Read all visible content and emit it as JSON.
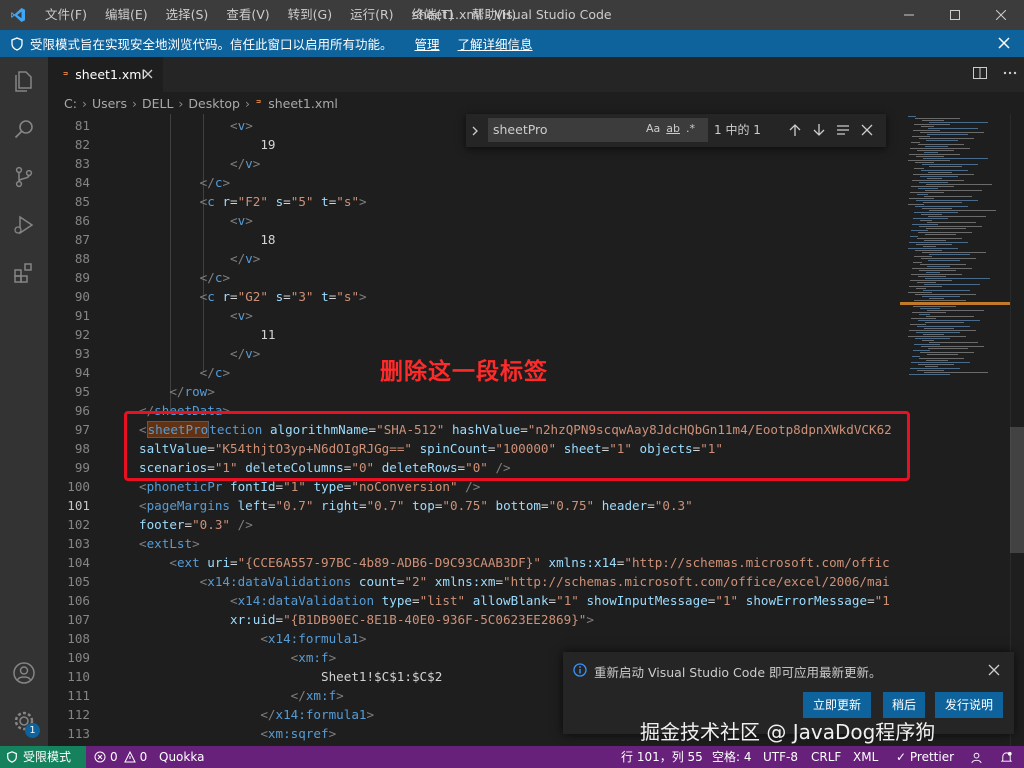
{
  "window": {
    "title": "sheet1.xml - Visual Studio Code",
    "menu": [
      "文件(F)",
      "编辑(E)",
      "选择(S)",
      "查看(V)",
      "转到(G)",
      "运行(R)",
      "终端(T)",
      "帮助(H)"
    ]
  },
  "banner": {
    "message": "受限模式旨在实现安全地浏览代码。信任此窗口以启用所有功能。",
    "manage": "管理",
    "learn_more": "了解详细信息"
  },
  "tab": {
    "label": "sheet1.xml"
  },
  "breadcrumb": {
    "items": [
      "C:",
      "Users",
      "DELL",
      "Desktop",
      "sheet1.xml"
    ]
  },
  "find": {
    "query": "sheetPro",
    "match_case": "Aa",
    "whole_word": "ab",
    "regex": ".*",
    "result": "1 中的 1"
  },
  "code": {
    "cur_line": 101,
    "lines": [
      {
        "n": 81,
        "t": "            <v>"
      },
      {
        "n": 82,
        "t": "                19"
      },
      {
        "n": 83,
        "t": "            </v>"
      },
      {
        "n": 84,
        "t": "        </c>"
      },
      {
        "n": 85,
        "t": "        <c r=\"F2\" s=\"5\" t=\"s\">"
      },
      {
        "n": 86,
        "t": "            <v>"
      },
      {
        "n": 87,
        "t": "                18"
      },
      {
        "n": 88,
        "t": "            </v>"
      },
      {
        "n": 89,
        "t": "        </c>"
      },
      {
        "n": 90,
        "t": "        <c r=\"G2\" s=\"3\" t=\"s\">"
      },
      {
        "n": 91,
        "t": "            <v>"
      },
      {
        "n": 92,
        "t": "                11"
      },
      {
        "n": 93,
        "t": "            </v>"
      },
      {
        "n": 94,
        "t": "        </c>"
      },
      {
        "n": 95,
        "t": "    </row>"
      },
      {
        "n": 96,
        "t": "</sheetData>"
      },
      {
        "n": 97,
        "t": "<sheetProtection algorithmName=\"SHA-512\" hashValue=\"n2hzQPN9scqwAay8JdcHQbGn11m4/Eootp8dpnXWkdVCK62"
      },
      {
        "n": 98,
        "t": "saltValue=\"K54thjtO3yp+N6dOIgRJGg==\" spinCount=\"100000\" sheet=\"1\" objects=\"1\""
      },
      {
        "n": 99,
        "t": "scenarios=\"1\" deleteColumns=\"0\" deleteRows=\"0\" />"
      },
      {
        "n": 100,
        "t": "<phoneticPr fontId=\"1\" type=\"noConversion\" />"
      },
      {
        "n": 101,
        "t": "<pageMargins left=\"0.7\" right=\"0.7\" top=\"0.75\" bottom=\"0.75\" header=\"0.3\""
      },
      {
        "n": 102,
        "t": "footer=\"0.3\" />"
      },
      {
        "n": 103,
        "t": "<extLst>"
      },
      {
        "n": 104,
        "t": "    <ext uri=\"{CCE6A557-97BC-4b89-ADB6-D9C93CAAB3DF}\" xmlns:x14=\"http://schemas.microsoft.com/offic"
      },
      {
        "n": 105,
        "t": "        <x14:dataValidations count=\"2\" xmlns:xm=\"http://schemas.microsoft.com/office/excel/2006/mai"
      },
      {
        "n": 106,
        "t": "            <x14:dataValidation type=\"list\" allowBlank=\"1\" showInputMessage=\"1\" showErrorMessage=\"1"
      },
      {
        "n": 107,
        "t": "            xr:uid=\"{B1DB90EC-8E1B-40E0-936F-5C0623EE2869}\">"
      },
      {
        "n": 108,
        "t": "                <x14:formula1>"
      },
      {
        "n": 109,
        "t": "                    <xm:f>"
      },
      {
        "n": 110,
        "t": "                        Sheet1!$C$1:$C$2"
      },
      {
        "n": 111,
        "t": "                    </xm:f>"
      },
      {
        "n": 112,
        "t": "                </x14:formula1>"
      },
      {
        "n": 113,
        "t": "                <xm:sqref>"
      }
    ]
  },
  "annotation": {
    "label": "删除这一段标签"
  },
  "notification": {
    "message": "重新启动 Visual Studio Code 即可应用最新更新。",
    "buttons": [
      "立即更新",
      "稍后",
      "发行说明"
    ]
  },
  "watermark": "掘金技术社区 @ JavaDog程序狗",
  "statusbar": {
    "restricted": "受限模式",
    "errors": "0",
    "warnings": "0",
    "quokka": "Quokka",
    "position": "行 101，列 55",
    "spaces": "空格: 4",
    "encoding": "UTF-8",
    "eol": "CRLF",
    "language": "XML",
    "prettier": "✓ Prettier"
  },
  "accounts_badge": "1",
  "colors": {
    "accent": "#0e639c",
    "statusbar": "#68217a",
    "restricted": "#16825d",
    "annotation": "#e81123"
  }
}
